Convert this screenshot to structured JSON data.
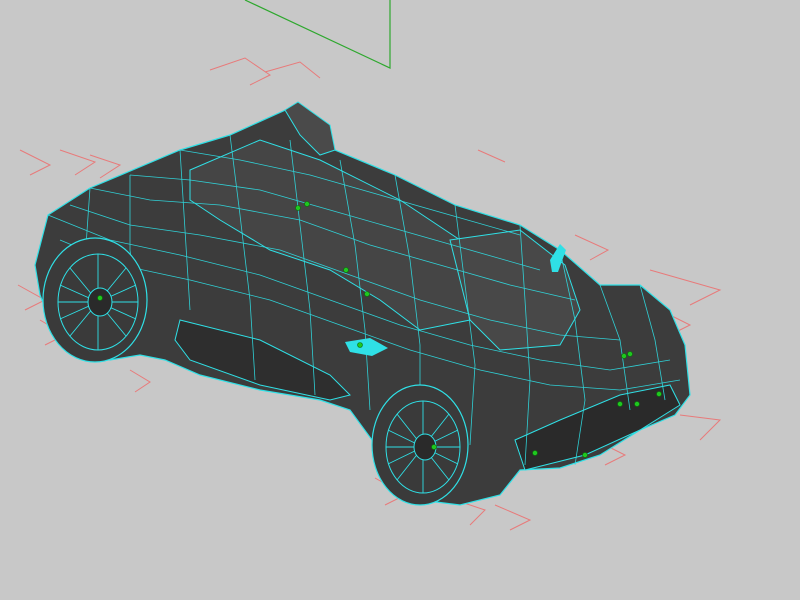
{
  "viewport": {
    "background": "#c8c8c8",
    "view": "perspective",
    "display_mode": "wireframe-on-shaded"
  },
  "model": {
    "name": "sports-car",
    "body_color": "#3c3c3c",
    "wire_color": "#2fe0e6",
    "selection_color": "#2fe0e6",
    "locator_color": "#1fc81f"
  },
  "helpers": {
    "grid_axis_color": "#2ea82e",
    "bounding_marker_color": "#e87a7a"
  }
}
